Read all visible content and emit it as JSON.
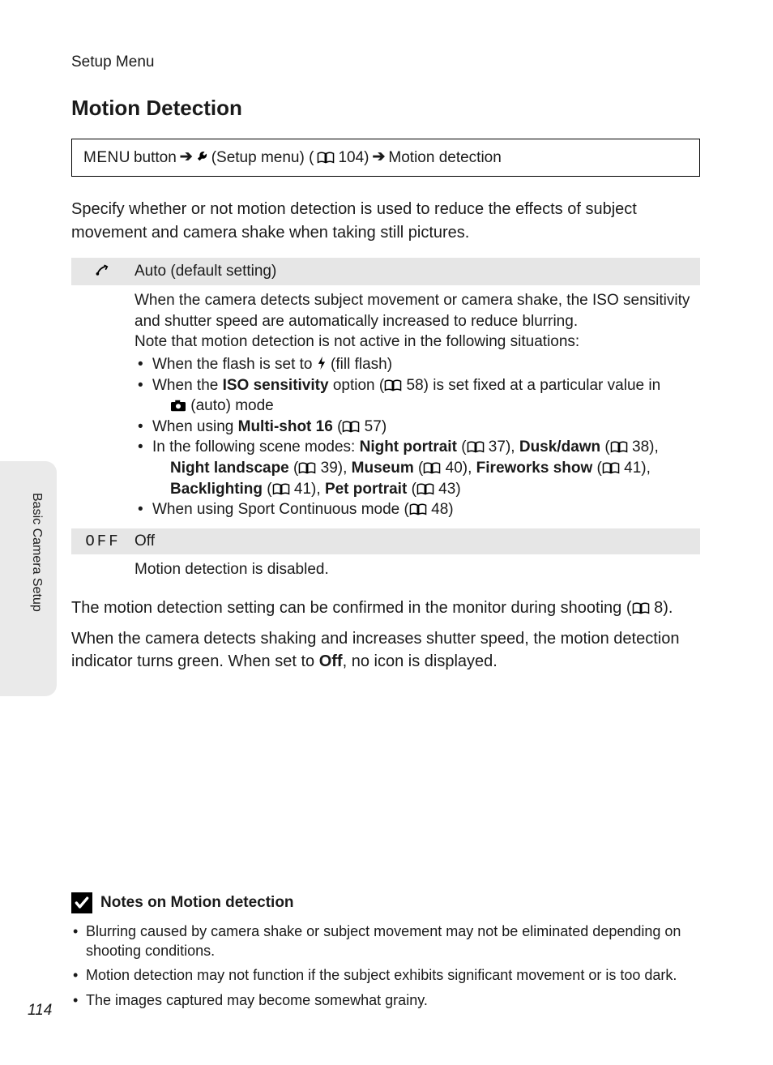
{
  "section_label": "Setup Menu",
  "title": "Motion Detection",
  "nav": {
    "menu_word": "MENU",
    "button_word": "button",
    "setup_text": "(Setup menu) (",
    "setup_ref": " 104)",
    "dest": "Motion detection"
  },
  "intro": "Specify whether or not motion detection is used to reduce the effects of subject movement and camera shake when taking still pictures.",
  "option_auto": {
    "label": "Auto (default setting)",
    "line1": "When the camera detects subject movement or camera shake, the ISO sensitivity and shutter speed are automatically increased to reduce blurring.",
    "line2": "Note that motion detection is not active in the following situations:",
    "b1_a": "When the flash is set to ",
    "b1_b": " (fill flash)",
    "b2_a": "When the ",
    "b2_iso": "ISO sensitivity",
    "b2_b": " option (",
    "b2_ref": " 58) is set fixed at a particular value in ",
    "b2_c": " (auto) mode",
    "b3_a": "When using ",
    "b3_multi": "Multi-shot 16",
    "b3_b": " (",
    "b3_ref": " 57)",
    "b4_a": "In the following scene modes: ",
    "b4_np": "Night portrait",
    "b4_np_ref": " 37), ",
    "b4_dd": "Dusk/dawn",
    "b4_dd_ref": " 38), ",
    "b4_nl": "Night landscape",
    "b4_nl_ref": " 39), ",
    "b4_mu": "Museum",
    "b4_mu_ref": " 40), ",
    "b4_fw": "Fireworks show",
    "b4_fw_ref": " 41), ",
    "b4_bl": "Backlighting",
    "b4_bl_ref": " 41), ",
    "b4_pp": "Pet portrait",
    "b4_pp_ref": " 43)",
    "b5_a": "When using Sport Continuous mode (",
    "b5_ref": " 48)"
  },
  "option_off": {
    "icon_text": "OFF",
    "label": "Off",
    "body": "Motion detection is disabled."
  },
  "para1_a": "The motion detection setting can be confirmed in the monitor during shooting (",
  "para1_ref": " 8).",
  "para2_a": "When the camera detects shaking and increases shutter speed, the motion detection indicator turns green. When set to ",
  "para2_off": "Off",
  "para2_b": ", no icon is displayed.",
  "side_label": "Basic Camera Setup",
  "notes": {
    "title": "Notes on Motion detection",
    "n1": "Blurring caused by camera shake or subject movement may not be eliminated depending on shooting conditions.",
    "n2": "Motion detection may not function if the subject exhibits significant movement or is too dark.",
    "n3": "The images captured may become somewhat grainy."
  },
  "page_number": "114"
}
